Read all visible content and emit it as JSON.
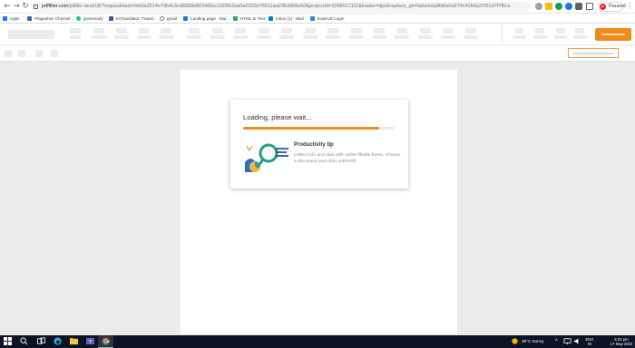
{
  "browser": {
    "url_host": "pdffiller.com",
    "url_path": "/jsfiller-desk18/?requestHash=bb0a2014e7db4c3cd8959e802d65cc1505b2aa0a2303e76511aa23b3d69e60&projectId=1008017111&loader=tips&replace_gh=false#da9fd6a0a574c42b6a37f51d7f7f6ce",
    "profile_initial": "P",
    "profile_label": "Paused",
    "bookmarks": [
      "Apps",
      "Plagiarism Checker...",
      "grammarly",
      "ImTranslator: Transl...",
      "gmail",
      "Landing page - Mul...",
      "HTML to Text",
      "Inbox (1) - Mail",
      "EaseUS Login"
    ]
  },
  "loader": {
    "title": "Loading, please wait...",
    "progress": 0.9,
    "tip_title": "Productivity tip",
    "tip_body": "Collect info and data with online fillable forms. Choose a document and click LinkToFill."
  },
  "taskbar": {
    "weather": "39°C  Sunny",
    "lang_line1": "ENG",
    "lang_line2": "IN",
    "time": "5:03 pm",
    "date": "17-May-2022"
  },
  "colors": {
    "accent": "#f08a1a",
    "progress_fill": "#e9902c",
    "taskbar": "#0c1322"
  }
}
